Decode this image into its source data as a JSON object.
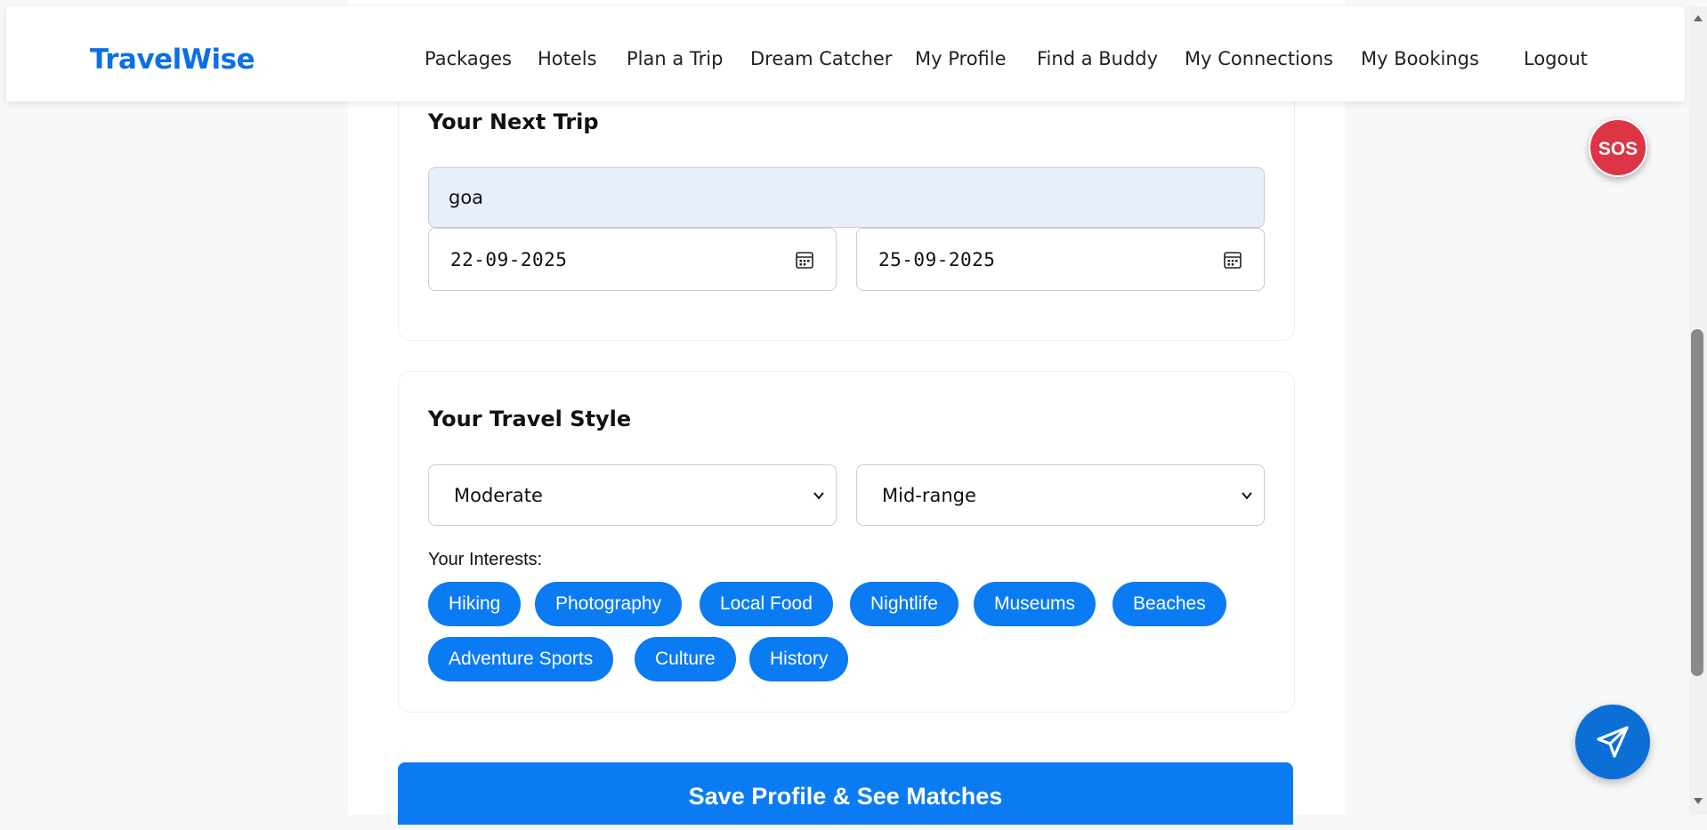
{
  "brand": "TravelWise",
  "nav": {
    "packages": "Packages",
    "hotels": "Hotels",
    "plan_trip": "Plan a Trip",
    "dream_catcher": "Dream Catcher",
    "my_profile": "My Profile",
    "find_buddy": "Find a Buddy",
    "my_connections": "My Connections",
    "my_bookings": "My Bookings",
    "logout": "Logout"
  },
  "next_trip": {
    "title": "Your Next Trip",
    "destination": "goa",
    "start_date": "22-09-2025",
    "end_date": "25-09-2025"
  },
  "travel_style": {
    "title": "Your Travel Style",
    "pace": "Moderate",
    "budget": "Mid-range",
    "interests_label": "Your Interests:",
    "interests": [
      "Hiking",
      "Photography",
      "Local Food",
      "Nightlife",
      "Museums",
      "Beaches",
      "Adventure Sports",
      "Culture",
      "History"
    ]
  },
  "save_button": "Save Profile & See Matches",
  "sos_label": "SOS",
  "icons": {
    "calendar": "calendar-icon",
    "chevron": "chevron-down-icon",
    "send": "send-icon"
  },
  "colors": {
    "primary": "#0b7bf3",
    "brand": "#0b6fe8",
    "sos": "#dc3545",
    "destination_fill": "#e8effb"
  }
}
